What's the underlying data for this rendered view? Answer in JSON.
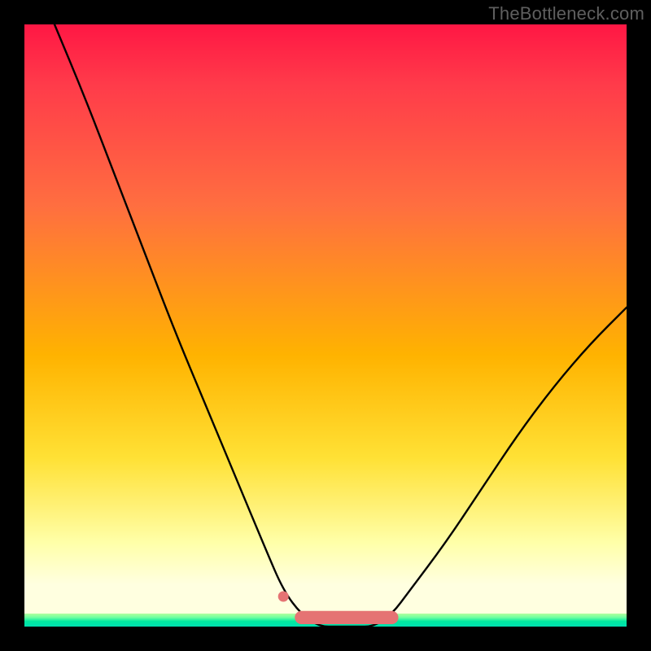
{
  "watermark": "TheBottleneck.com",
  "chart_data": {
    "type": "line",
    "title": "",
    "xlabel": "",
    "ylabel": "",
    "xlim": [
      0,
      100
    ],
    "ylim": [
      0,
      100
    ],
    "grid": false,
    "legend": false,
    "series": [
      {
        "name": "curve",
        "color": "#000000",
        "x": [
          5,
          10,
          15,
          20,
          25,
          30,
          35,
          40,
          43,
          46,
          49,
          52,
          55,
          58,
          61,
          64,
          70,
          76,
          82,
          88,
          94,
          100
        ],
        "y": [
          100,
          88,
          75,
          62,
          49,
          37,
          25,
          13,
          6,
          2,
          0,
          0,
          0,
          0,
          2,
          6,
          14,
          23,
          32,
          40,
          47,
          53
        ]
      }
    ],
    "valley_markers": {
      "color": "#e57373",
      "dot": {
        "x": 43,
        "y": 5
      },
      "bar": {
        "x0": 46,
        "x1": 61,
        "y": 1.5,
        "thickness": 2.2
      }
    },
    "background_gradient": {
      "top": "#ff1744",
      "mid": "#ffe135",
      "bottom_band": "#00e8a0"
    }
  }
}
